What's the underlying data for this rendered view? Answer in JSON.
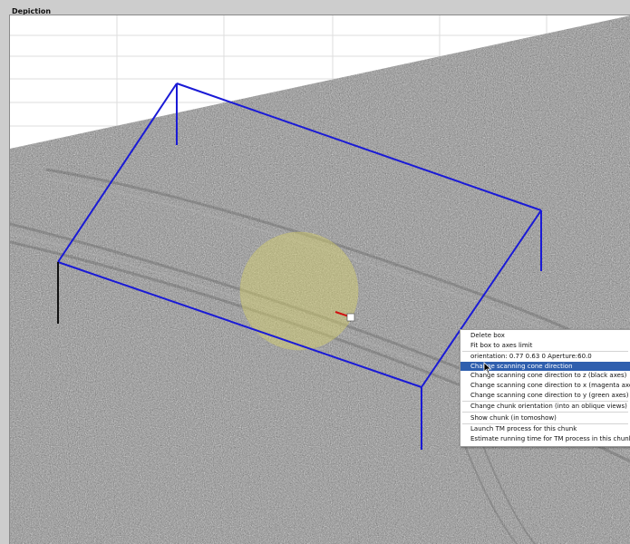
{
  "panel": {
    "title": "Depiction"
  },
  "viewport": {
    "box_color": "#1a1ad6",
    "tomogram_background": "#8c8c8c",
    "sphere_color": "#d9d36a"
  },
  "context_menu": {
    "items": [
      {
        "label": "Delete box",
        "selected": false
      },
      {
        "label": "Fit box to axes limit",
        "selected": false
      },
      {
        "label": "orientation: 0.77 0.63   0  Aperture:60.0",
        "selected": false
      },
      {
        "label": "Change scanning cone  direction",
        "selected": true
      },
      {
        "label": "Change scanning cone direction to z (black axes)",
        "selected": false
      },
      {
        "label": "Change scanning cone direction to x (magenta axes)",
        "selected": false
      },
      {
        "label": "Change scanning cone direction to y (green axes)",
        "selected": false
      },
      {
        "label": "Change chunk orientation (into an oblique views)",
        "selected": false
      },
      {
        "label": "Show chunk (in tomoshow)",
        "selected": false
      },
      {
        "label": "Launch TM process for this chunk",
        "selected": false
      },
      {
        "label": "Estimate running time for TM process in this chunk",
        "selected": false
      }
    ]
  }
}
